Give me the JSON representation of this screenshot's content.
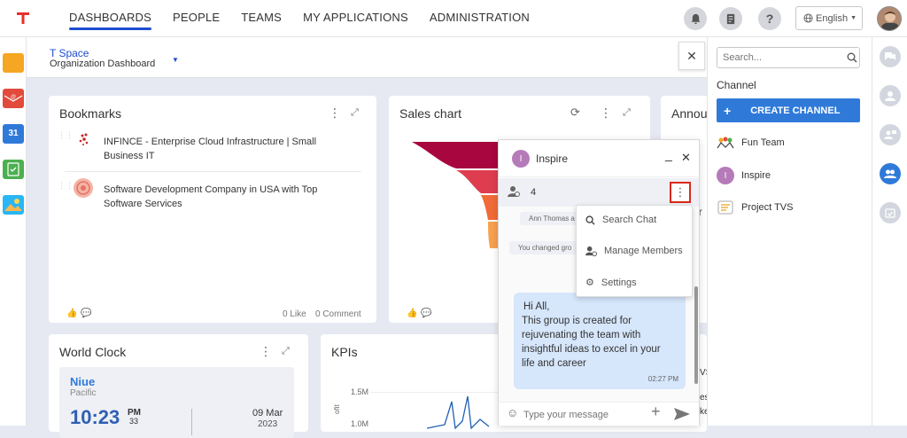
{
  "nav": {
    "items": [
      "DASHBOARDS",
      "PEOPLE",
      "TEAMS",
      "MY APPLICATIONS",
      "ADMINISTRATION"
    ],
    "active": "DASHBOARDS"
  },
  "language": "English",
  "space": {
    "name": "T Space",
    "dashboard": "Organization Dashboard"
  },
  "bookmarks": {
    "title": "Bookmarks",
    "items": [
      {
        "line1": "INFINCE - Enterprise Cloud Infrastructure | Small",
        "line2": "Business IT"
      },
      {
        "line1": "Software Development Company in USA with Top",
        "line2": "Software Services"
      }
    ],
    "likes": "0 Like",
    "comments": "0 Comment"
  },
  "sales": {
    "title": "Sales chart"
  },
  "announcements": {
    "title": "Annou"
  },
  "world_clock": {
    "title": "World Clock",
    "city": "Niue",
    "region": "Pacific",
    "time": "10:23",
    "ampm": "PM",
    "seconds": "33",
    "date": "09 Mar",
    "year": "2023"
  },
  "kpis": {
    "title": "KPIs",
    "y1": "1.5M",
    "y2": "1.0M",
    "axis": "ofit"
  },
  "chat": {
    "title": "Inspire",
    "avatar_letter": "I",
    "members_count": "4",
    "sys_msg1": "Ann Thomas a",
    "sys_msg2": "You changed gro",
    "message": {
      "line1": "Hi All,",
      "line2": "This group is created for",
      "line3": "rejuvenating the team with",
      "line4": "insightful ideas to excel in your",
      "line5": "life and career",
      "time": "02:27 PM"
    },
    "placeholder": "Type your message"
  },
  "chat_menu": {
    "items": [
      "Search Chat",
      "Manage Members",
      "Settings"
    ]
  },
  "sidebar": {
    "search_placeholder": "Search...",
    "section": "Channel",
    "create_button": "CREATE CHANNEL",
    "channels": [
      {
        "name": "Fun Team"
      },
      {
        "name": "Inspire",
        "letter": "I"
      },
      {
        "name": "Project TVS"
      }
    ]
  },
  "partial": {
    "ar": "ar",
    "vs": "VS",
    "es": "es",
    "ke": "ke"
  }
}
